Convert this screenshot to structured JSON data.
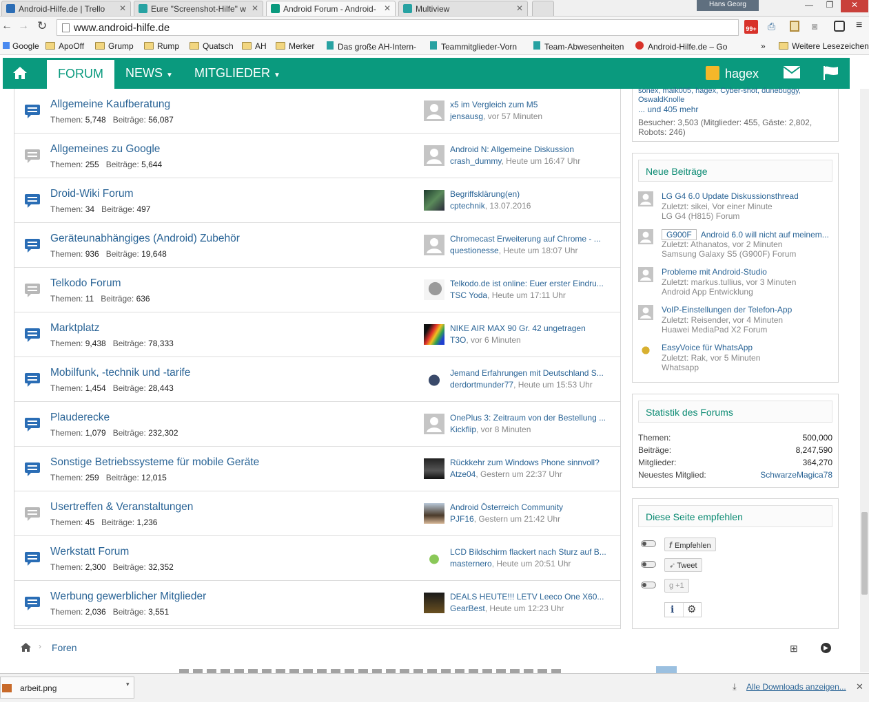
{
  "browser": {
    "tabs": [
      {
        "title": "Android-Hilfe.de | Trello",
        "color": "#2c6db5"
      },
      {
        "title": "Eure \"Screenshot-Hilfe\" w",
        "color": "#27a2a2"
      },
      {
        "title": "Android Forum - Android-",
        "color": "#0a9a7e"
      },
      {
        "title": "Multiview",
        "color": "#27a2a2"
      }
    ],
    "user": "Hans Georg",
    "url": "www.android-hilfe.de",
    "badge": "99+",
    "bookmarks": [
      "Google",
      "ApoOff",
      "Grump",
      "Rump",
      "Quatsch",
      "AH",
      "Merker",
      "Das große AH-Intern-",
      "Teammitglieder-Vorn",
      "Team-Abwesenheiten",
      "Android-Hilfe.de – Go",
      "»",
      "Weitere Lesezeichen"
    ]
  },
  "nav": {
    "forum": "FORUM",
    "news": "NEWS",
    "members": "MITGLIEDER",
    "username": "hagex",
    "brand_color": "#0a9a7e"
  },
  "stats_labels": {
    "themen": "Themen:",
    "beitraege": "Beiträge:"
  },
  "forums": [
    {
      "title": "Allgemeine Kaufberatung",
      "themen": "5,748",
      "beitraege": "56,087",
      "unread": true,
      "last_thread": "x5 im Vergleich zum M5",
      "last_user": "jensausg",
      "last_time": ", vor 57 Minuten",
      "avatar": "default"
    },
    {
      "title": "Allgemeines zu Google",
      "themen": "255",
      "beitraege": "5,644",
      "unread": false,
      "last_thread": "Android N: Allgemeine Diskussion",
      "last_user": "crash_dummy",
      "last_time": ", Heute um 16:47 Uhr",
      "avatar": "default"
    },
    {
      "title": "Droid-Wiki Forum",
      "themen": "34",
      "beitraege": "497",
      "unread": true,
      "last_thread": "Begriffsklärung(en)",
      "last_user": "cptechnik",
      "last_time": ", 13.07.2016",
      "avatar": "dark"
    },
    {
      "title": "Geräteunabhängiges (Android) Zubehör",
      "themen": "936",
      "beitraege": "19,648",
      "unread": true,
      "last_thread": "Chromecast Erweiterung auf Chrome - ...",
      "last_user": "questionesse",
      "last_time": ", Heute um 18:07 Uhr",
      "avatar": "default"
    },
    {
      "title": "Telkodo Forum",
      "themen": "11",
      "beitraege": "636",
      "unread": false,
      "last_thread": "Telkodo.de ist online: Euer erster Eindru...",
      "last_user": "TSC Yoda",
      "last_time": ", Heute um 17:11 Uhr",
      "avatar": "yoda"
    },
    {
      "title": "Marktplatz",
      "themen": "9,438",
      "beitraege": "78,333",
      "unread": true,
      "last_thread": "NIKE AIR MAX 90 Gr. 42 ungetragen",
      "last_user": "T3O",
      "last_time": ", vor 6 Minuten",
      "avatar": "rainbow"
    },
    {
      "title": "Mobilfunk, -technik und -tarife",
      "themen": "1,454",
      "beitraege": "28,443",
      "unread": true,
      "last_thread": "Jemand Erfahrungen mit Deutschland S...",
      "last_user": "derdortmunder77",
      "last_time": ", Heute um 15:53 Uhr",
      "avatar": "figure"
    },
    {
      "title": "Plauderecke",
      "themen": "1,079",
      "beitraege": "232,302",
      "unread": true,
      "last_thread": "OnePlus 3: Zeitraum von der Bestellung ...",
      "last_user": "Kickflip",
      "last_time": ", vor 8 Minuten",
      "avatar": "default"
    },
    {
      "title": "Sonstige Betriebssysteme für mobile Geräte",
      "themen": "259",
      "beitraege": "12,015",
      "unread": true,
      "last_thread": "Rückkehr zum Windows Phone sinnvoll?",
      "last_user": "Atze04",
      "last_time": ", Gestern um 22:37 Uhr",
      "avatar": "vader"
    },
    {
      "title": "Usertreffen & Veranstaltungen",
      "themen": "45",
      "beitraege": "1,236",
      "unread": false,
      "last_thread": "Android Österreich Community",
      "last_user": "PJF16",
      "last_time": ", Gestern um 21:42 Uhr",
      "avatar": "person"
    },
    {
      "title": "Werkstatt Forum",
      "themen": "2,300",
      "beitraege": "32,352",
      "unread": true,
      "last_thread": "LCD Bildschirm flackert nach Sturz auf B...",
      "last_user": "masternero",
      "last_time": ", Heute um 20:51 Uhr",
      "avatar": "droid"
    },
    {
      "title": "Werbung gewerblicher Mitglieder",
      "themen": "2,036",
      "beitraege": "3,551",
      "unread": true,
      "last_thread": "DEALS HEUTE!!! LETV Leeco One X60...",
      "last_user": "GearBest",
      "last_time": ", Heute um 12:23 Uhr",
      "avatar": "gear"
    }
  ],
  "online": {
    "names_line": "sonex, maik005, hagex, Cyber-shot, dunebuggy,",
    "name_last": "OswaldKnolle",
    "more": "... und 405 mehr",
    "visitors_line1": "Besucher: 3,503 (Mitglieder: 455, Gäste: 2,802,",
    "visitors_line2": "Robots: 246)"
  },
  "new_posts": {
    "title": "Neue Beiträge",
    "items": [
      {
        "thread": "LG G4 6.0 Update Diskussionsthread",
        "prefix": "",
        "meta": "Zuletzt: sikei, Vor einer Minute",
        "forum": "LG G4 (H815) Forum",
        "avatar": "default"
      },
      {
        "thread": "Android 6.0 will nicht auf meinem...",
        "prefix": "G900F",
        "meta": "Zuletzt: Athanatos, vor 2 Minuten",
        "forum": "Samsung Galaxy S5 (G900F) Forum",
        "avatar": "default"
      },
      {
        "thread": "Probleme mit Android-Studio",
        "prefix": "",
        "meta": "Zuletzt: markus.tullius, vor 3 Minuten",
        "forum": "Android App Entwicklung",
        "avatar": "default"
      },
      {
        "thread": "VoIP-Einstellungen der Telefon-App",
        "prefix": "",
        "meta": "Zuletzt: Reisender, vor 4 Minuten",
        "forum": "Huawei MediaPad X2 Forum",
        "avatar": "default"
      },
      {
        "thread": "EasyVoice für WhatsApp",
        "prefix": "",
        "meta": "Zuletzt: Rak, vor 5 Minuten",
        "forum": "Whatsapp",
        "avatar": "bee"
      }
    ]
  },
  "statistics": {
    "title": "Statistik des Forums",
    "rows": [
      {
        "label": "Themen:",
        "value": "500,000"
      },
      {
        "label": "Beiträge:",
        "value": "8,247,590"
      },
      {
        "label": "Mitglieder:",
        "value": "364,270"
      },
      {
        "label": "Neuestes Mitglied:",
        "value": "SchwarzeMagica78"
      }
    ]
  },
  "share": {
    "title": "Diese Seite empfehlen",
    "facebook": "Empfehlen",
    "twitter": "Tweet",
    "google": "+1"
  },
  "breadcrumb": {
    "item": "Foren"
  },
  "downloads": {
    "file": "arbeit.png",
    "show_all": "Alle Downloads anzeigen..."
  }
}
